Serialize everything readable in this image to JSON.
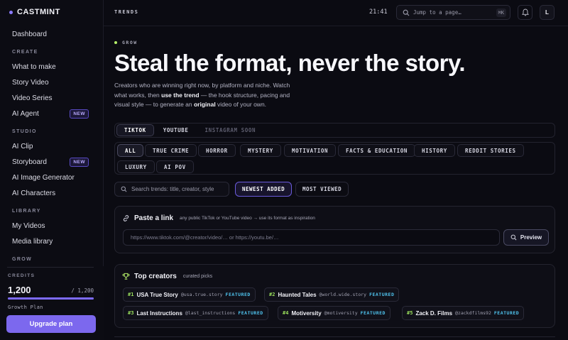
{
  "app": {
    "name": "CASTMINT"
  },
  "sidebar": {
    "items_top": [
      {
        "label": "Dashboard"
      }
    ],
    "create": {
      "title": "CREATE",
      "items": [
        {
          "label": "What to make"
        },
        {
          "label": "Story Video"
        },
        {
          "label": "Video Series"
        },
        {
          "label": "AI Agent",
          "badge": "NEW"
        }
      ]
    },
    "studio": {
      "title": "STUDIO",
      "items": [
        {
          "label": "AI Clip"
        },
        {
          "label": "Storyboard",
          "badge": "NEW"
        },
        {
          "label": "AI Image Generator"
        },
        {
          "label": "AI Characters"
        }
      ]
    },
    "library": {
      "title": "LIBRARY",
      "items": [
        {
          "label": "My Videos"
        },
        {
          "label": "Media library"
        }
      ]
    },
    "grow": {
      "title": "GROW"
    },
    "credits": {
      "label": "CREDITS",
      "value": "1,200",
      "max": "/ 1,200",
      "fill_percent": 100,
      "plan": "Growth Plan",
      "upgrade_label": "Upgrade plan"
    }
  },
  "topbar": {
    "title": "TRENDS",
    "time": "21:41",
    "jump_placeholder": "Jump to a page…",
    "jump_shortcut": "⌘K",
    "avatar_initial": "L"
  },
  "hero": {
    "eyebrow": "GROW",
    "headline": "Steal the format, never the story.",
    "intro_1": "Creators who are winning right now, by platform and niche. Watch what works, then ",
    "intro_bold_1": "use the trend",
    "intro_2": " — the hook structure, pacing and visual style — to generate an ",
    "intro_bold_2": "original",
    "intro_3": " video of your own."
  },
  "platforms": [
    {
      "label": "TIKTOK",
      "active": true
    },
    {
      "label": "YOUTUBE",
      "active": false
    },
    {
      "label": "INSTAGRAM SOON",
      "disabled": true
    }
  ],
  "categories": [
    {
      "label": "ALL",
      "active": true
    },
    {
      "label": "TRUE CRIME"
    },
    {
      "label": "HORROR"
    },
    {
      "label": "MYSTERY"
    },
    {
      "label": "MOTIVATION"
    },
    {
      "label": "FACTS & EDUCATION"
    },
    {
      "label": "HISTORY"
    },
    {
      "label": "REDDIT STORIES"
    },
    {
      "label": "LUXURY"
    },
    {
      "label": "AI POV"
    }
  ],
  "search": {
    "placeholder": "Search trends: title, creator, style"
  },
  "sort": [
    {
      "label": "NEWEST ADDED",
      "active": true
    },
    {
      "label": "MOST VIEWED",
      "active": false
    }
  ],
  "paste": {
    "title": "Paste a link",
    "subtitle": "any public TikTok or YouTube video → use its format as inspiration",
    "placeholder": "https://www.tiktok.com/@creator/video/… or https://youtu.be/…",
    "preview_label": "Preview"
  },
  "creators": {
    "title": "Top creators",
    "subtitle": "curated picks",
    "list": [
      {
        "rank": "#1",
        "name": "USA True Story",
        "handle": "@usa.true.story",
        "tag": "FEATURED"
      },
      {
        "rank": "#2",
        "name": "Haunted Tales",
        "handle": "@world.wide.story",
        "tag": "FEATURED"
      },
      {
        "rank": "#3",
        "name": "Last Instructions",
        "handle": "@last_instructions",
        "tag": "FEATURED"
      },
      {
        "rank": "#4",
        "name": "Motiversity",
        "handle": "@motiversity",
        "tag": "FEATURED"
      },
      {
        "rank": "#5",
        "name": "Zack D. Films",
        "handle": "@zackdfilms92",
        "tag": "FEATURED"
      }
    ]
  },
  "colors": {
    "accent": "#7c68ee",
    "lime": "#b5f06a",
    "featured": "#4fc3ee",
    "background": "#0b0b12"
  }
}
